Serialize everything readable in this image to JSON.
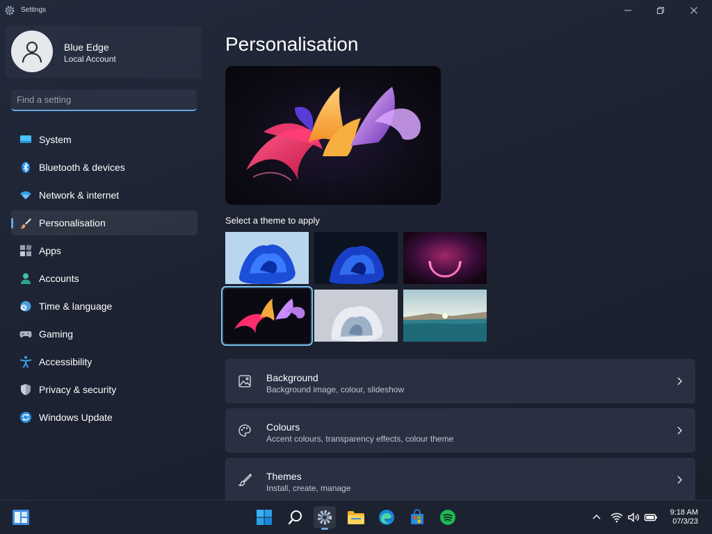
{
  "window": {
    "title": "Settings"
  },
  "profile": {
    "name": "Blue Edge",
    "account_type": "Local Account"
  },
  "search": {
    "placeholder": "Find a setting"
  },
  "sidebar": {
    "items": [
      {
        "label": "System",
        "icon": "system-icon"
      },
      {
        "label": "Bluetooth & devices",
        "icon": "bluetooth-icon"
      },
      {
        "label": "Network & internet",
        "icon": "wifi-icon"
      },
      {
        "label": "Personalisation",
        "icon": "brush-icon",
        "active": true
      },
      {
        "label": "Apps",
        "icon": "apps-icon"
      },
      {
        "label": "Accounts",
        "icon": "accounts-icon"
      },
      {
        "label": "Time & language",
        "icon": "clock-globe-icon"
      },
      {
        "label": "Gaming",
        "icon": "gamepad-icon"
      },
      {
        "label": "Accessibility",
        "icon": "accessibility-icon"
      },
      {
        "label": "Privacy & security",
        "icon": "shield-icon"
      },
      {
        "label": "Windows Update",
        "icon": "update-icon"
      }
    ]
  },
  "main": {
    "title": "Personalisation",
    "themes_label": "Select a theme to apply",
    "themes": [
      {
        "name": "windows-light-bloom"
      },
      {
        "name": "windows-dark-bloom"
      },
      {
        "name": "glow"
      },
      {
        "name": "captured-motion",
        "selected": true
      },
      {
        "name": "sunrise-flow"
      },
      {
        "name": "flow-lake"
      }
    ],
    "cards": [
      {
        "title": "Background",
        "subtitle": "Background image, colour, slideshow",
        "icon": "image-icon"
      },
      {
        "title": "Colours",
        "subtitle": "Accent colours, transparency effects, colour theme",
        "icon": "palette-icon"
      },
      {
        "title": "Themes",
        "subtitle": "Install, create, manage",
        "icon": "brush-icon"
      }
    ]
  },
  "taskbar": {
    "apps": [
      "start",
      "search",
      "settings",
      "file-explorer",
      "edge",
      "store",
      "spotify"
    ],
    "clock": {
      "time": "9:18 AM",
      "date": "07/3/23"
    }
  },
  "colors": {
    "accent": "#6aa7e6",
    "background": "#1d2332",
    "card": "#283042"
  }
}
